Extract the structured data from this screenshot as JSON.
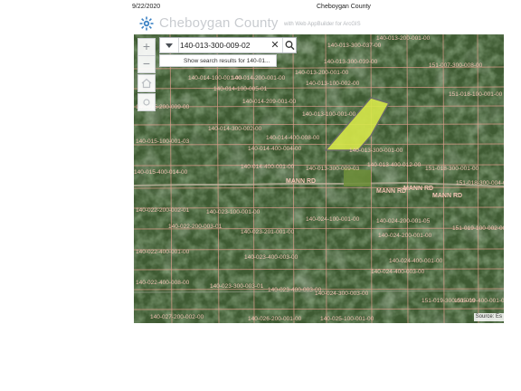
{
  "print": {
    "date": "9/22/2020",
    "title": "Cheboygan County"
  },
  "header": {
    "title": "Cheboygan County",
    "subtitle": "with Web AppBuilder for ArcGIS",
    "logo_icon": "gear-sun-icon"
  },
  "controls": {
    "zoom_in": "+",
    "zoom_out": "−",
    "side_buttons": [
      "home-icon",
      "locate-icon"
    ]
  },
  "search": {
    "value": "140-013-300-009-02",
    "clear_icon": "close-icon",
    "search_icon": "search-icon",
    "dropdown_icon": "caret-down-icon",
    "suggestion": "Show search results for 140-01..."
  },
  "map": {
    "attribution": "Source: Es",
    "colors": {
      "parcel_line": "#e8a090",
      "parcel_label": "#f2c2b4",
      "road_label": "#f5c4b6",
      "highlight": "#d7e84a",
      "highlight_outline": "#6b6b6b",
      "field": "#6f8f3a"
    },
    "road_labels": [
      "MANN RD",
      "MANN RD",
      "MANN RD",
      "MANN RD"
    ],
    "parcel_labels": [
      "140-014-100-001-00",
      "140-014-200-001-00",
      "140-013-200-001-00",
      "140-013-100-002-00",
      "140-013-100-001-00",
      "140-014-100-005-01",
      "140-014-209-001-00",
      "140-015-200-009-00",
      "140-014-300-002-00",
      "140-014-400-008-00",
      "140-013-300-001-00",
      "140-013-300-009-03",
      "140-013-400-012-00",
      "140-014-400-001-00",
      "140-015-400-014-00",
      "140-022-200-002-01",
      "140-023-100-001-00",
      "140-024-100-001-00",
      "140-024-200-001-05",
      "140-023-201-001-00",
      "140-022-200-003-01",
      "140-023-400-003-00",
      "140-024-400-001-00",
      "140-024-400-003-00",
      "140-022-400-001-00",
      "140-022-400-008-00",
      "140-023-300-003-01",
      "140-023-400-003-00",
      "140-024-300-003-00",
      "140-027-200-002-00",
      "140-026-200-001-00",
      "140-025-100-001-00",
      "151-018-100-001-00",
      "151-018-300-001-00",
      "151-018-300-004-01",
      "151-019-100-002-00",
      "151-019-300-005-00",
      "151-019-400-001-00",
      "140-015-100-001-03",
      "140-014-400-004-00",
      "151-007-300-008-00",
      "140-013-300-039-00",
      "140-013-300-037-00",
      "140-024-200-001-00",
      "140-013-200-001-00"
    ]
  }
}
